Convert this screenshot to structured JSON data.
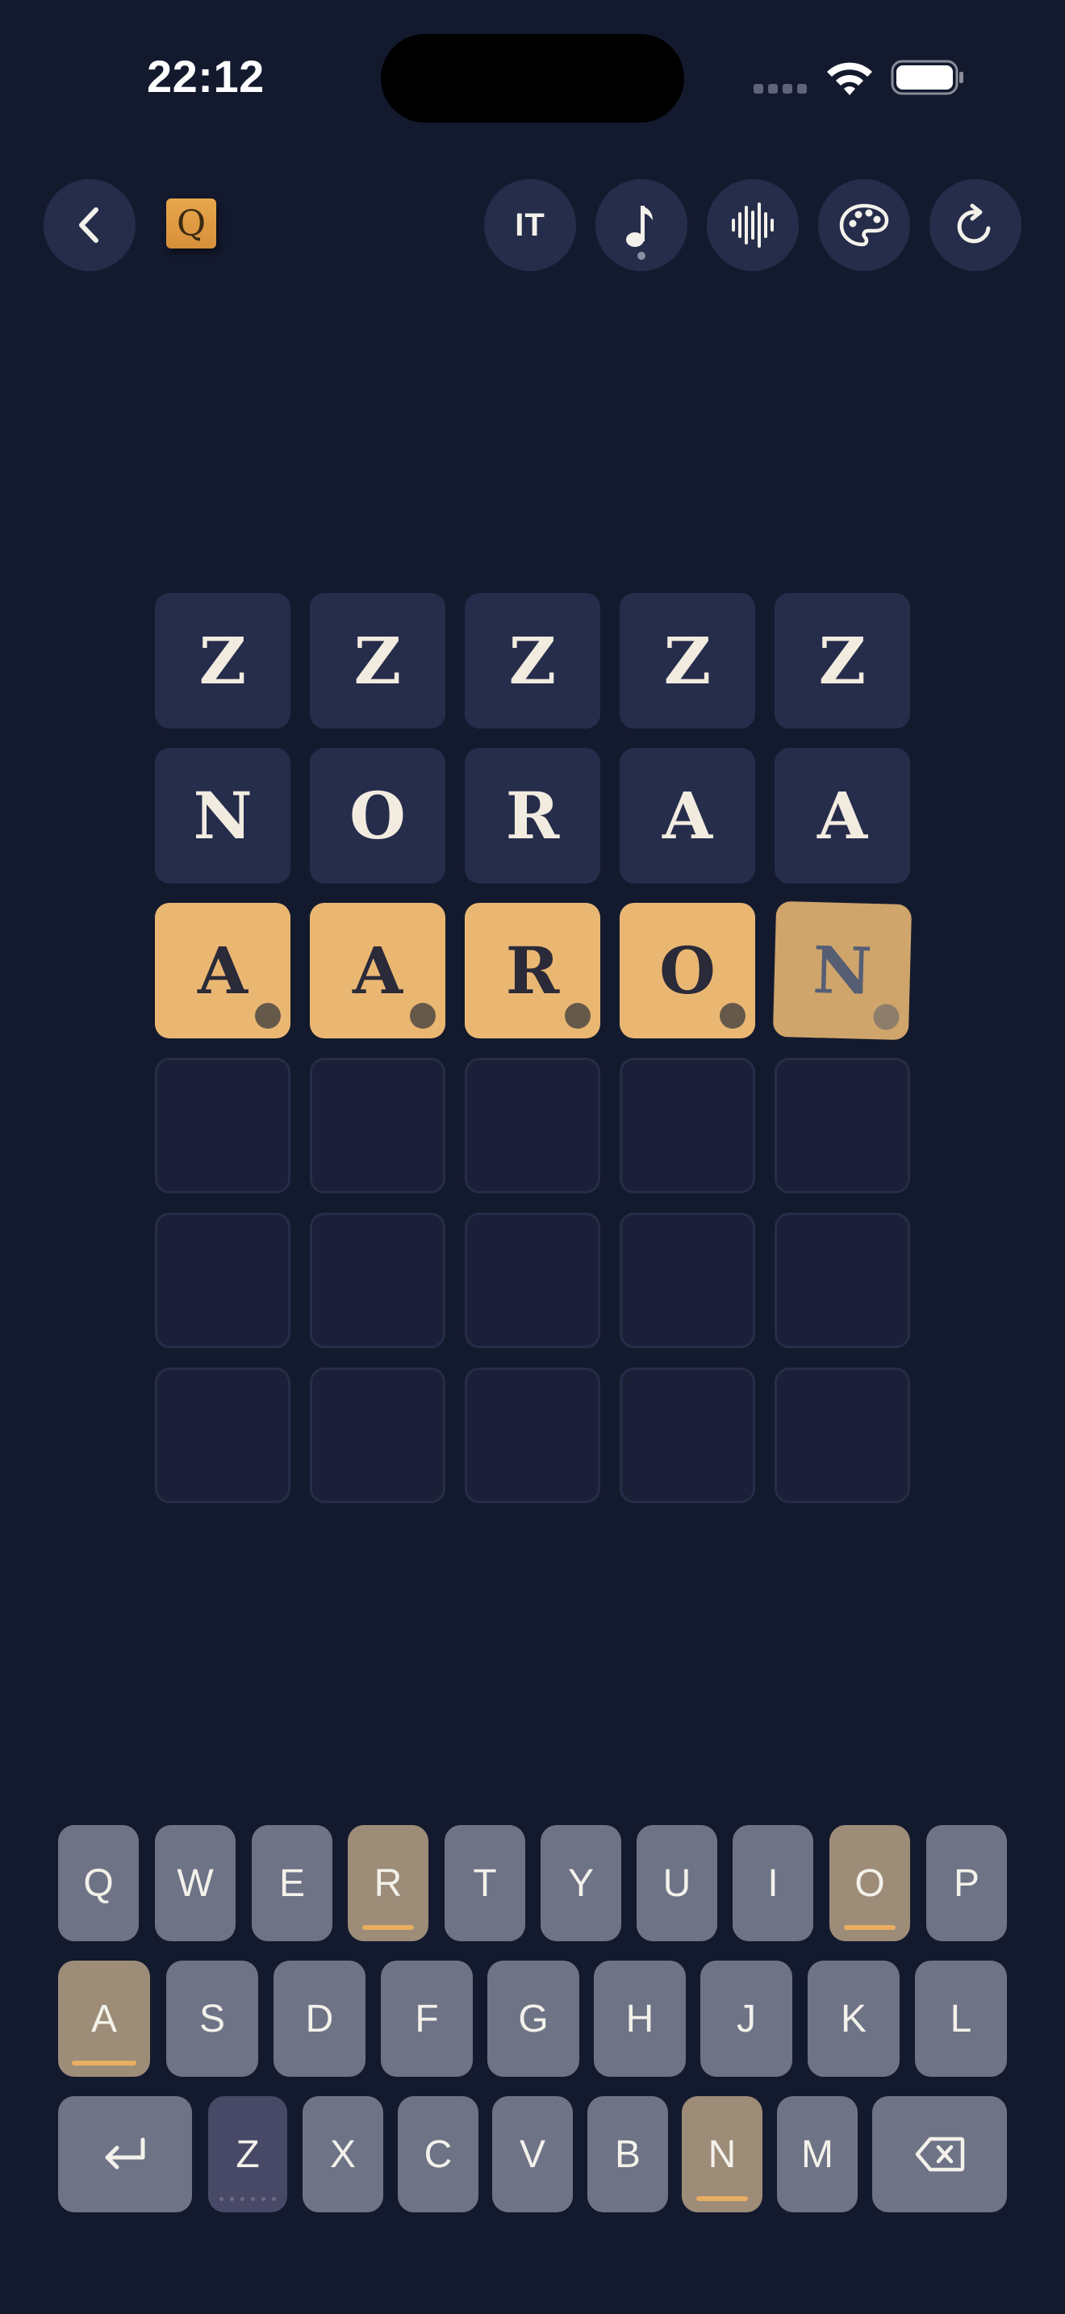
{
  "status_bar": {
    "time": "22:12"
  },
  "toolbar": {
    "language": "IT",
    "logo_letter": "Q",
    "icons": [
      "back-icon",
      "music-note-icon",
      "sound-wave-icon",
      "palette-icon",
      "refresh-icon"
    ]
  },
  "board": {
    "rows": [
      {
        "state": "filled",
        "letters": [
          "Z",
          "Z",
          "Z",
          "Z",
          "Z"
        ]
      },
      {
        "state": "filled",
        "letters": [
          "N",
          "O",
          "R",
          "A",
          "A"
        ]
      },
      {
        "state": "present",
        "letters": [
          "A",
          "A",
          "R",
          "O",
          "N"
        ]
      },
      {
        "state": "empty",
        "letters": [
          "",
          "",
          "",
          "",
          ""
        ]
      },
      {
        "state": "empty",
        "letters": [
          "",
          "",
          "",
          "",
          ""
        ]
      },
      {
        "state": "empty",
        "letters": [
          "",
          "",
          "",
          "",
          ""
        ]
      }
    ]
  },
  "keyboard": {
    "row1": [
      "Q",
      "W",
      "E",
      "R",
      "T",
      "Y",
      "U",
      "I",
      "O",
      "P"
    ],
    "row2": [
      "A",
      "S",
      "D",
      "F",
      "G",
      "H",
      "J",
      "K",
      "L"
    ],
    "row3": [
      "Z",
      "X",
      "C",
      "V",
      "B",
      "N",
      "M"
    ],
    "present_keys": [
      "R",
      "O",
      "A",
      "N"
    ],
    "absent_keys": [
      "Z"
    ],
    "enter_icon": "return-icon",
    "delete_icon": "backspace-icon"
  },
  "colors": {
    "background": "#141a2e",
    "tile_filled": "#262d4b",
    "tile_present": "#eab773",
    "key_default": "#6e7386",
    "key_present": "#9d8c78",
    "accent_bar": "#e9ae62"
  }
}
